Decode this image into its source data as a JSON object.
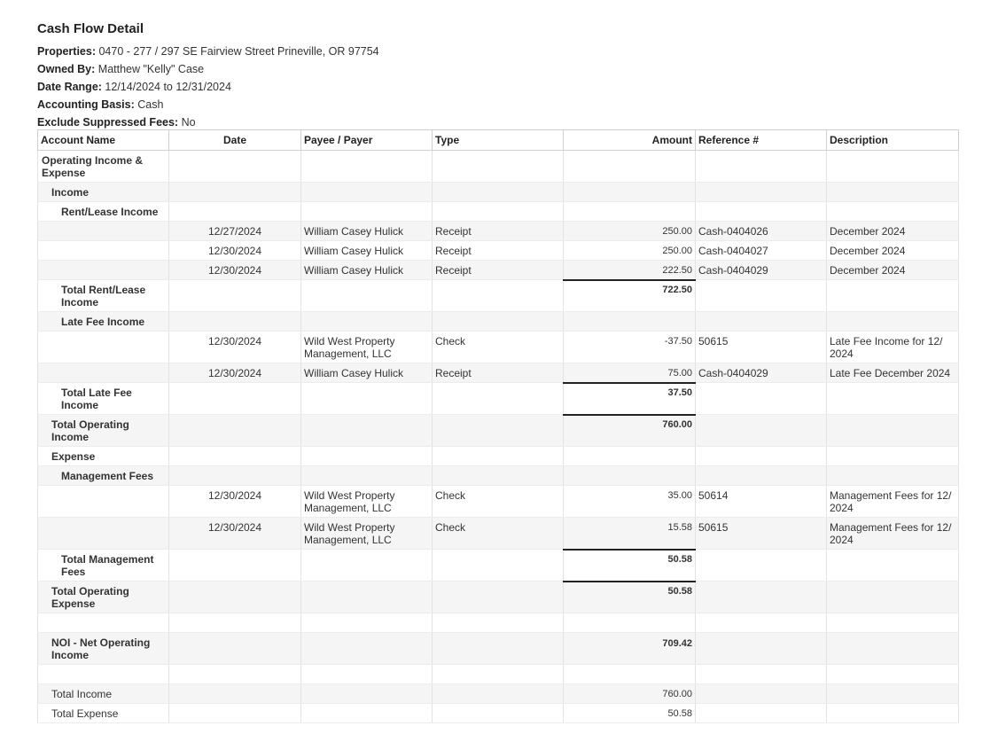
{
  "report": {
    "title": "Cash Flow Detail",
    "meta": [
      {
        "label": "Properties:",
        "value": "0470 - 277 / 297 SE Fairview Street Prineville, OR 97754"
      },
      {
        "label": "Owned By:",
        "value": "Matthew \"Kelly\" Case"
      },
      {
        "label": "Date Range:",
        "value": "12/14/2024 to 12/31/2024"
      },
      {
        "label": "Accounting Basis:",
        "value": "Cash"
      },
      {
        "label": "Exclude Suppressed Fees:",
        "value": "No"
      }
    ]
  },
  "columns": {
    "account": "Account Name",
    "date": "Date",
    "payee": "Payee / Payer",
    "type": "Type",
    "amount": "Amount",
    "reference": "Reference #",
    "description": "Description"
  },
  "rows": {
    "operating": "Operating Income & Expense",
    "income": "Income",
    "rent_lease": "Rent/Lease Income",
    "rent_tx": [
      {
        "date": "12/27/2024",
        "payee": "William Casey Hulick",
        "type": "Receipt",
        "amount": "250.00",
        "ref": "Cash-0404026",
        "desc": "December 2024"
      },
      {
        "date": "12/30/2024",
        "payee": "William Casey Hulick",
        "type": "Receipt",
        "amount": "250.00",
        "ref": "Cash-0404027",
        "desc": "December 2024"
      },
      {
        "date": "12/30/2024",
        "payee": "William Casey Hulick",
        "type": "Receipt",
        "amount": "222.50",
        "ref": "Cash-0404029",
        "desc": "December 2024"
      }
    ],
    "total_rent_lease": {
      "label": "Total Rent/Lease Income",
      "amount": "722.50"
    },
    "late_fee": "Late Fee Income",
    "late_tx": [
      {
        "date": "12/30/2024",
        "payee": "Wild West Property Management, LLC",
        "type": "Check",
        "amount": "-37.50",
        "ref": "50615",
        "desc": "Late Fee Income for 12/ 2024"
      },
      {
        "date": "12/30/2024",
        "payee": "William Casey Hulick",
        "type": "Receipt",
        "amount": "75.00",
        "ref": "Cash-0404029",
        "desc": "Late Fee December 2024"
      }
    ],
    "total_late_fee": {
      "label": "Total Late Fee Income",
      "amount": "37.50"
    },
    "total_op_income": {
      "label": "Total Operating Income",
      "amount": "760.00"
    },
    "expense": "Expense",
    "mgmt": "Management Fees",
    "mgmt_tx": [
      {
        "date": "12/30/2024",
        "payee": "Wild West Property Management, LLC",
        "type": "Check",
        "amount": "35.00",
        "ref": "50614",
        "desc": "Management Fees for 12/ 2024"
      },
      {
        "date": "12/30/2024",
        "payee": "Wild West Property Management, LLC",
        "type": "Check",
        "amount": "15.58",
        "ref": "50615",
        "desc": "Management Fees for 12/ 2024"
      }
    ],
    "total_mgmt": {
      "label": "Total Management Fees",
      "amount": "50.58"
    },
    "total_op_expense": {
      "label": "Total Operating Expense",
      "amount": "50.58"
    },
    "noi": {
      "label": "NOI - Net Operating Income",
      "amount": "709.42"
    },
    "total_income": {
      "label": "Total Income",
      "amount": "760.00"
    },
    "total_expense": {
      "label": "Total Expense",
      "amount": "50.58"
    }
  }
}
